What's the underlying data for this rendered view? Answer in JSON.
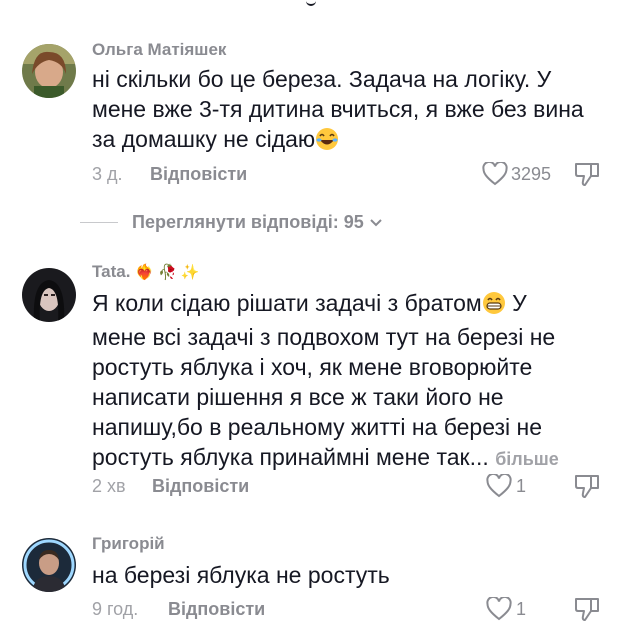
{
  "comments": [
    {
      "author": "Ольга Матіяшек",
      "lines": [
        "ні скільки бо це береза. Задача на логіку. У",
        "мене вже 3-тя дитина вчиться, я вже без вина",
        "за домашку не сідаю"
      ],
      "emoji_icon": "laughing-emoji-icon",
      "time": "3 д.",
      "reply_label": "Відповісти",
      "likes": "3295"
    },
    {
      "author": "Tata.",
      "author_emojis": "❤️‍🔥 🥀 ✨",
      "lines": [
        "Я коли сідаю рішати задачі з братом",
        "мене всі задачі з подвохом тут на березі не",
        "ростуть яблука і хоч, як мене вговорюйте",
        "написати рішення я все ж таки його не",
        "напишу,бо в реальному житті на березі не",
        "ростуть яблука принаймні мене так..."
      ],
      "line0_suffix": " У",
      "more_label": "більше",
      "time": "2 хв",
      "reply_label": "Відповісти",
      "likes": "1"
    },
    {
      "author": "Григорій",
      "lines": [
        "на березі яблука не ростуть"
      ],
      "time": "9 год.",
      "reply_label": "Відповісти",
      "likes": "1"
    }
  ],
  "view_replies": "Переглянути відповіді: 95",
  "colors": {
    "text": "#161823",
    "secondary": "#8a8b91",
    "muted": "#a1a2a7"
  }
}
